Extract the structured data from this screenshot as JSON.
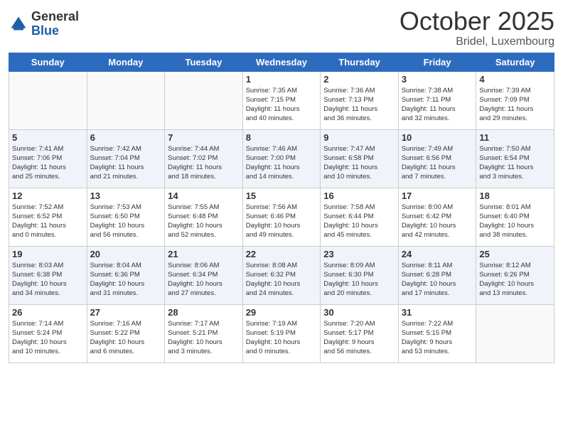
{
  "header": {
    "logo_general": "General",
    "logo_blue": "Blue",
    "month_title": "October 2025",
    "location": "Bridel, Luxembourg"
  },
  "weekdays": [
    "Sunday",
    "Monday",
    "Tuesday",
    "Wednesday",
    "Thursday",
    "Friday",
    "Saturday"
  ],
  "weeks": [
    [
      {
        "day": "",
        "info": ""
      },
      {
        "day": "",
        "info": ""
      },
      {
        "day": "",
        "info": ""
      },
      {
        "day": "1",
        "info": "Sunrise: 7:35 AM\nSunset: 7:15 PM\nDaylight: 11 hours\nand 40 minutes."
      },
      {
        "day": "2",
        "info": "Sunrise: 7:36 AM\nSunset: 7:13 PM\nDaylight: 11 hours\nand 36 minutes."
      },
      {
        "day": "3",
        "info": "Sunrise: 7:38 AM\nSunset: 7:11 PM\nDaylight: 11 hours\nand 32 minutes."
      },
      {
        "day": "4",
        "info": "Sunrise: 7:39 AM\nSunset: 7:09 PM\nDaylight: 11 hours\nand 29 minutes."
      }
    ],
    [
      {
        "day": "5",
        "info": "Sunrise: 7:41 AM\nSunset: 7:06 PM\nDaylight: 11 hours\nand 25 minutes."
      },
      {
        "day": "6",
        "info": "Sunrise: 7:42 AM\nSunset: 7:04 PM\nDaylight: 11 hours\nand 21 minutes."
      },
      {
        "day": "7",
        "info": "Sunrise: 7:44 AM\nSunset: 7:02 PM\nDaylight: 11 hours\nand 18 minutes."
      },
      {
        "day": "8",
        "info": "Sunrise: 7:46 AM\nSunset: 7:00 PM\nDaylight: 11 hours\nand 14 minutes."
      },
      {
        "day": "9",
        "info": "Sunrise: 7:47 AM\nSunset: 6:58 PM\nDaylight: 11 hours\nand 10 minutes."
      },
      {
        "day": "10",
        "info": "Sunrise: 7:49 AM\nSunset: 6:56 PM\nDaylight: 11 hours\nand 7 minutes."
      },
      {
        "day": "11",
        "info": "Sunrise: 7:50 AM\nSunset: 6:54 PM\nDaylight: 11 hours\nand 3 minutes."
      }
    ],
    [
      {
        "day": "12",
        "info": "Sunrise: 7:52 AM\nSunset: 6:52 PM\nDaylight: 11 hours\nand 0 minutes."
      },
      {
        "day": "13",
        "info": "Sunrise: 7:53 AM\nSunset: 6:50 PM\nDaylight: 10 hours\nand 56 minutes."
      },
      {
        "day": "14",
        "info": "Sunrise: 7:55 AM\nSunset: 6:48 PM\nDaylight: 10 hours\nand 52 minutes."
      },
      {
        "day": "15",
        "info": "Sunrise: 7:56 AM\nSunset: 6:46 PM\nDaylight: 10 hours\nand 49 minutes."
      },
      {
        "day": "16",
        "info": "Sunrise: 7:58 AM\nSunset: 6:44 PM\nDaylight: 10 hours\nand 45 minutes."
      },
      {
        "day": "17",
        "info": "Sunrise: 8:00 AM\nSunset: 6:42 PM\nDaylight: 10 hours\nand 42 minutes."
      },
      {
        "day": "18",
        "info": "Sunrise: 8:01 AM\nSunset: 6:40 PM\nDaylight: 10 hours\nand 38 minutes."
      }
    ],
    [
      {
        "day": "19",
        "info": "Sunrise: 8:03 AM\nSunset: 6:38 PM\nDaylight: 10 hours\nand 34 minutes."
      },
      {
        "day": "20",
        "info": "Sunrise: 8:04 AM\nSunset: 6:36 PM\nDaylight: 10 hours\nand 31 minutes."
      },
      {
        "day": "21",
        "info": "Sunrise: 8:06 AM\nSunset: 6:34 PM\nDaylight: 10 hours\nand 27 minutes."
      },
      {
        "day": "22",
        "info": "Sunrise: 8:08 AM\nSunset: 6:32 PM\nDaylight: 10 hours\nand 24 minutes."
      },
      {
        "day": "23",
        "info": "Sunrise: 8:09 AM\nSunset: 6:30 PM\nDaylight: 10 hours\nand 20 minutes."
      },
      {
        "day": "24",
        "info": "Sunrise: 8:11 AM\nSunset: 6:28 PM\nDaylight: 10 hours\nand 17 minutes."
      },
      {
        "day": "25",
        "info": "Sunrise: 8:12 AM\nSunset: 6:26 PM\nDaylight: 10 hours\nand 13 minutes."
      }
    ],
    [
      {
        "day": "26",
        "info": "Sunrise: 7:14 AM\nSunset: 5:24 PM\nDaylight: 10 hours\nand 10 minutes."
      },
      {
        "day": "27",
        "info": "Sunrise: 7:16 AM\nSunset: 5:22 PM\nDaylight: 10 hours\nand 6 minutes."
      },
      {
        "day": "28",
        "info": "Sunrise: 7:17 AM\nSunset: 5:21 PM\nDaylight: 10 hours\nand 3 minutes."
      },
      {
        "day": "29",
        "info": "Sunrise: 7:19 AM\nSunset: 5:19 PM\nDaylight: 10 hours\nand 0 minutes."
      },
      {
        "day": "30",
        "info": "Sunrise: 7:20 AM\nSunset: 5:17 PM\nDaylight: 9 hours\nand 56 minutes."
      },
      {
        "day": "31",
        "info": "Sunrise: 7:22 AM\nSunset: 5:15 PM\nDaylight: 9 hours\nand 53 minutes."
      },
      {
        "day": "",
        "info": ""
      }
    ]
  ]
}
